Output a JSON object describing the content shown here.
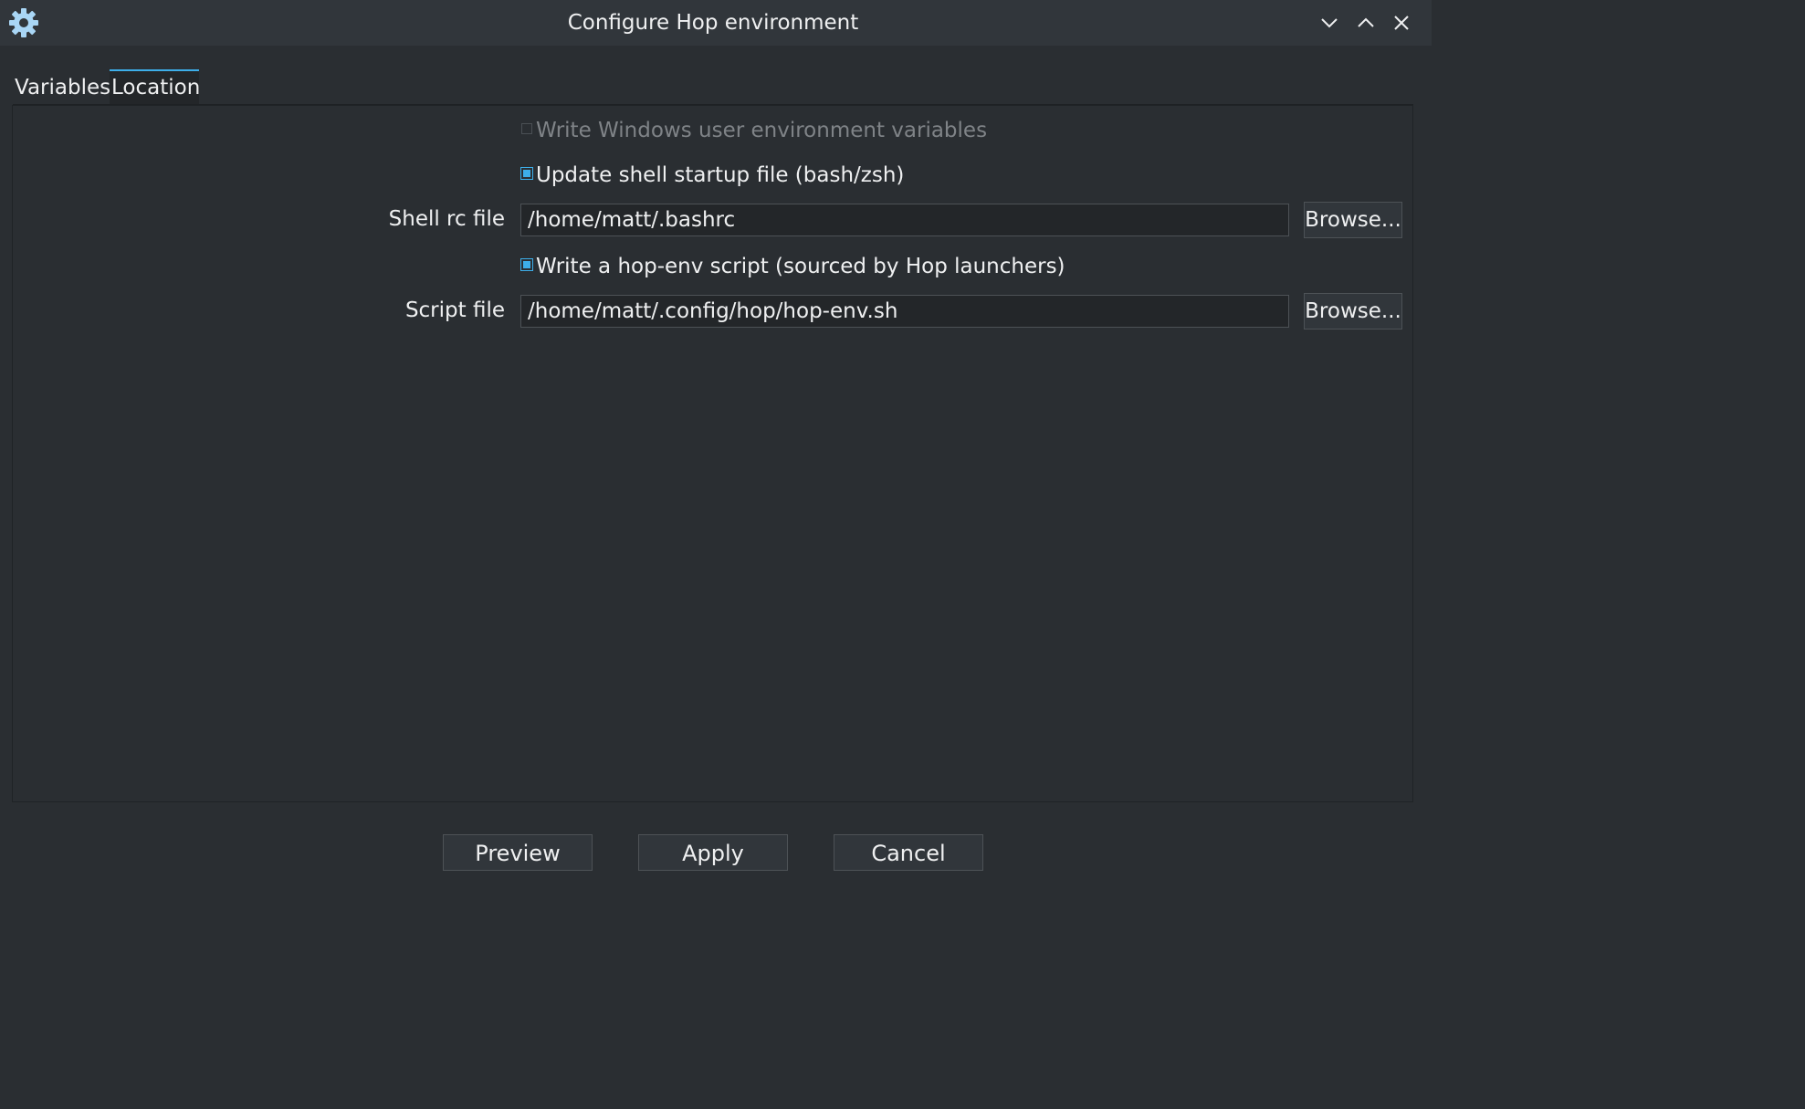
{
  "window": {
    "title": "Configure Hop environment",
    "app_icon": "gear-icon",
    "controls": [
      "minimize-icon",
      "maximize-icon",
      "close-icon"
    ]
  },
  "tabs": [
    {
      "label": "Variables",
      "active": false
    },
    {
      "label": "Location",
      "active": true
    }
  ],
  "location": {
    "windows_vars": {
      "label": "Write Windows user environment variables",
      "checked": false,
      "enabled": false
    },
    "shell_startup": {
      "label": "Update shell startup file (bash/zsh)",
      "checked": true,
      "enabled": true
    },
    "shell_rc": {
      "label": "Shell rc file",
      "value": "/home/matt/.bashrc",
      "browse_label": "Browse..."
    },
    "hop_env_script": {
      "label": "Write a hop-env script (sourced by Hop launchers)",
      "checked": true,
      "enabled": true
    },
    "script_file": {
      "label": "Script file",
      "value": "/home/matt/.config/hop/hop-env.sh",
      "browse_label": "Browse..."
    }
  },
  "buttons": {
    "preview": "Preview",
    "apply": "Apply",
    "cancel": "Cancel"
  },
  "colors": {
    "accent": "#3daee9",
    "background": "#2a2e32",
    "field_background": "#232629",
    "text": "#eff0f1"
  }
}
